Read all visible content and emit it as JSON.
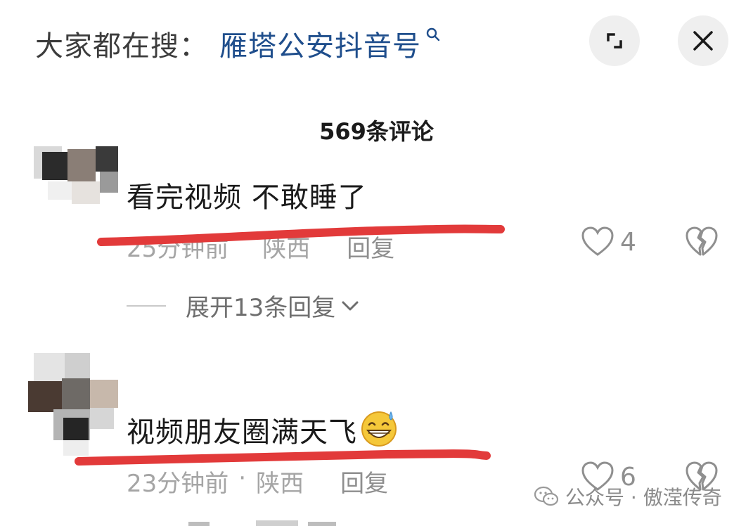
{
  "search": {
    "prefix": "大家都在搜：",
    "term": "雁塔公安抖音号"
  },
  "header": {
    "comment_count": "569条评论"
  },
  "comments": [
    {
      "text": "看完视频 不敢睡了",
      "time": "25分钟前",
      "location": "陕西",
      "reply": "回复",
      "likes": "4",
      "expand_label": "展开13条回复"
    },
    {
      "text": "视频朋友圈满天飞",
      "emoji": "grinning-sweat-emoji",
      "time": "23分钟前",
      "dot": "·",
      "location": "陕西",
      "reply": "回复",
      "likes": "6"
    }
  ],
  "watermark": {
    "text": "公众号 · 傲滢传奇"
  },
  "icons": {
    "search": "search-icon",
    "expand": "expand-icon",
    "close": "close-icon",
    "like": "heart-icon",
    "dislike": "broken-heart-icon",
    "chevron": "chevron-down-icon",
    "wechat": "wechat-icon"
  },
  "colors": {
    "search_term": "#1f4e8c",
    "red_underline": "#e23a3a",
    "meta_text": "#a5a5a5"
  }
}
